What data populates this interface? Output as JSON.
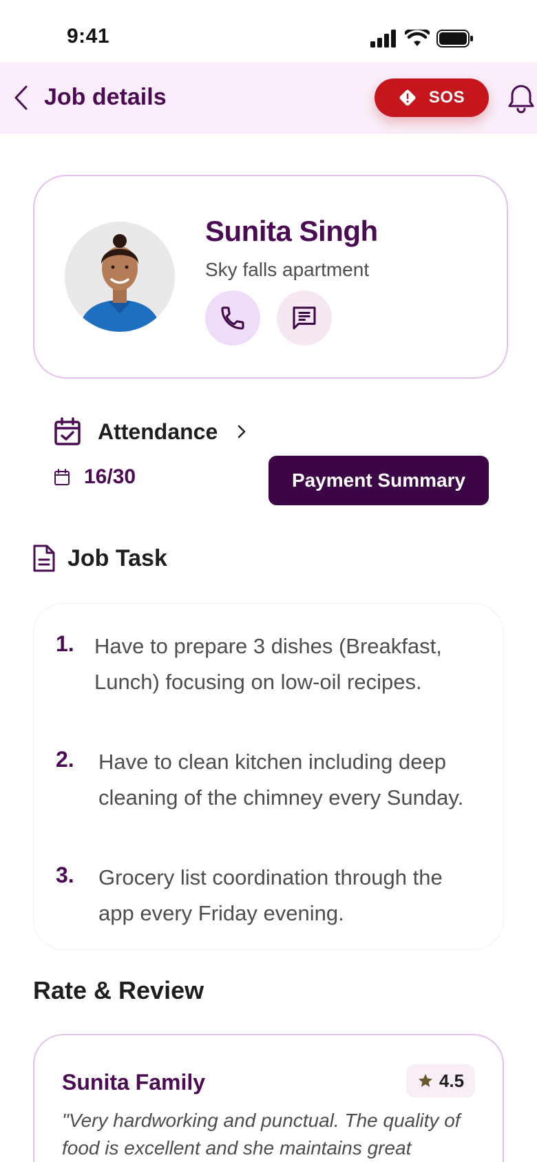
{
  "status_bar": {
    "time": "9:41"
  },
  "header": {
    "title": "Job details",
    "sos_label": "SOS"
  },
  "profile": {
    "name": "Sunita Singh",
    "location": "Sky falls apartment"
  },
  "attendance": {
    "label": "Attendance",
    "count": "16/30",
    "payment_button": "Payment Summary"
  },
  "job_task": {
    "title": "Job Task",
    "items": [
      {
        "number": "1.",
        "text": "Have to prepare 3 dishes (Breakfast, Lunch) focusing on low-oil recipes."
      },
      {
        "number": "2.",
        "text": "Have to clean kitchen including deep cleaning of the chimney every Sunday."
      },
      {
        "number": "3.",
        "text": "Grocery list coordination through the app every Friday evening."
      }
    ]
  },
  "review": {
    "section_title": "Rate & Review",
    "reviewer": "Sunita Family",
    "rating": "4.5",
    "text": "\"Very hardworking and punctual. The quality of food is excellent and she maintains great"
  },
  "colors": {
    "brand": "#4a0b52",
    "sos": "#c4161c",
    "header_bg": "#f9eef9",
    "button_dark": "#3c0545"
  },
  "icons": [
    "signal-icon",
    "wifi-icon",
    "battery-icon",
    "back-arrow-icon",
    "sos-alert-icon",
    "bell-icon",
    "phone-icon",
    "chat-icon",
    "calendar-check-icon",
    "chevron-right-icon",
    "calendar-icon",
    "document-icon",
    "star-icon"
  ]
}
